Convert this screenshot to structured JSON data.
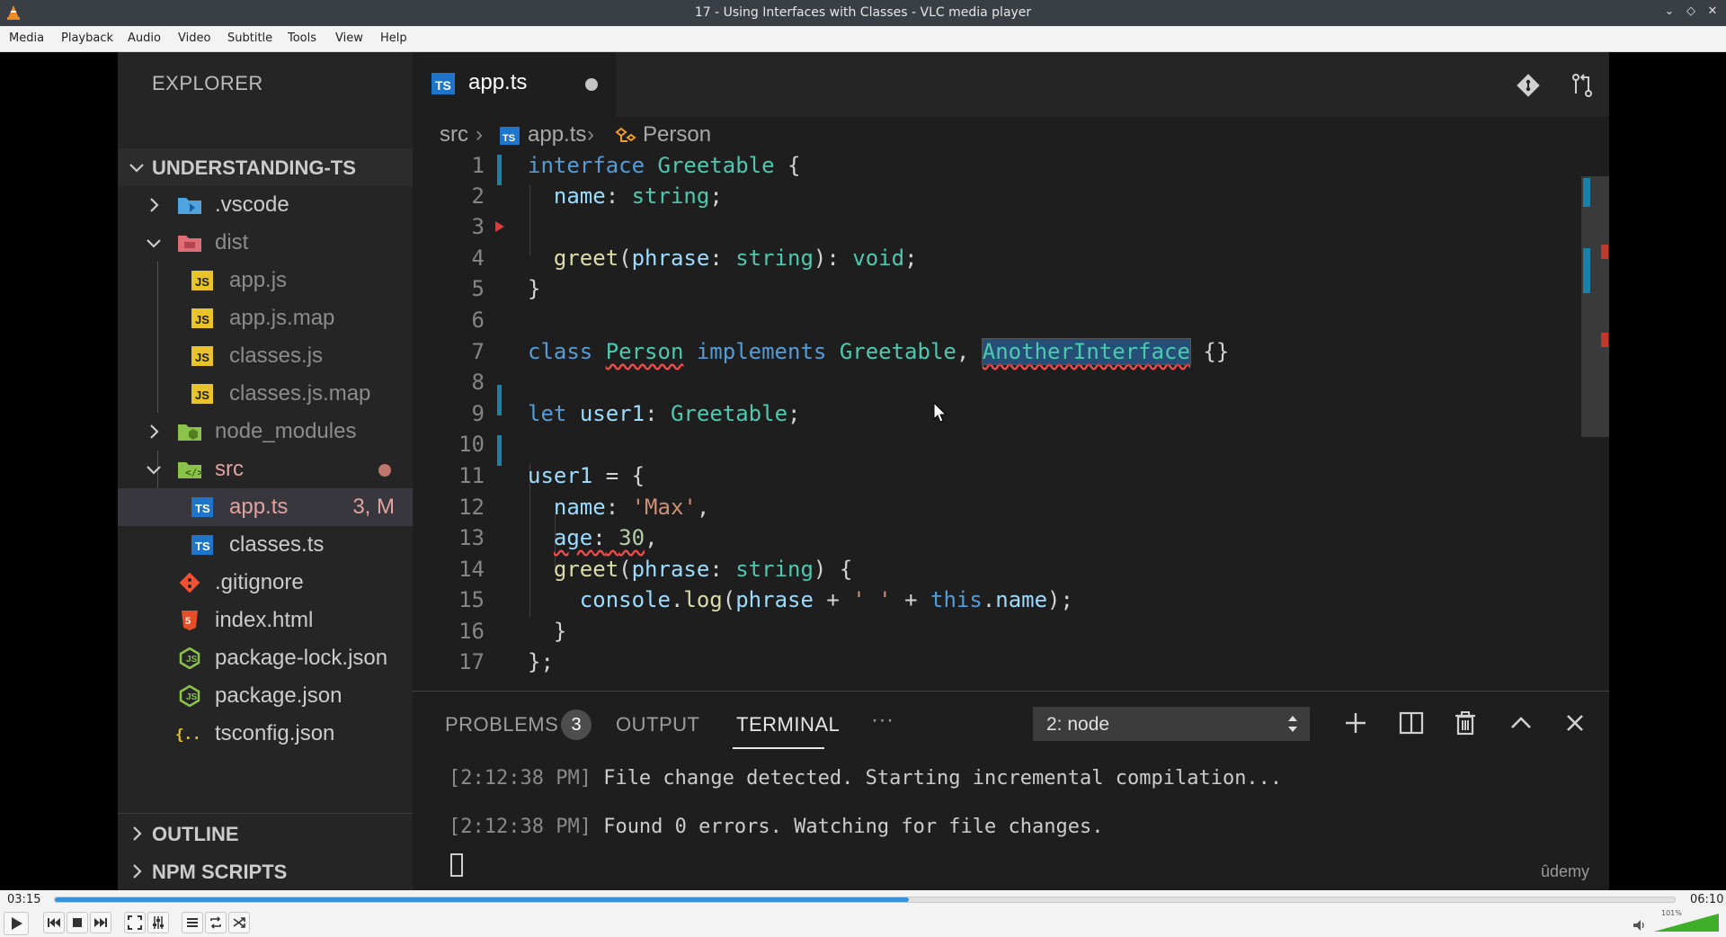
{
  "window": {
    "title": "17 - Using Interfaces with Classes - VLC media player"
  },
  "menu": [
    "Media",
    "Playback",
    "Audio",
    "Video",
    "Subtitle",
    "Tools",
    "View",
    "Help"
  ],
  "explorer": {
    "title": "EXPLORER",
    "project": "UNDERSTANDING-TS",
    "tree": [
      {
        "label": ".vscode",
        "type": "folder",
        "color": "#4fa3e0"
      },
      {
        "label": "dist",
        "type": "folder-open",
        "color": "#e06c75",
        "dim": true
      },
      {
        "label": "app.js",
        "type": "js",
        "dim": true
      },
      {
        "label": "app.js.map",
        "type": "js",
        "dim": true
      },
      {
        "label": "classes.js",
        "type": "js",
        "dim": true
      },
      {
        "label": "classes.js.map",
        "type": "js",
        "dim": true
      },
      {
        "label": "node_modules",
        "type": "folder",
        "color": "#8bc34a",
        "dim": true
      },
      {
        "label": "src",
        "type": "folder-open",
        "color": "#8bc34a"
      },
      {
        "label": "app.ts",
        "type": "ts",
        "badge": "3, M"
      },
      {
        "label": "classes.ts",
        "type": "ts"
      },
      {
        "label": ".gitignore",
        "type": "git"
      },
      {
        "label": "index.html",
        "type": "html"
      },
      {
        "label": "package-lock.json",
        "type": "node"
      },
      {
        "label": "package.json",
        "type": "node"
      },
      {
        "label": "tsconfig.json",
        "type": "json"
      }
    ],
    "outline": "OUTLINE",
    "npm_scripts": "NPM SCRIPTS"
  },
  "editor": {
    "tab": "app.ts",
    "breadcrumb": [
      "src",
      "app.ts",
      "Person"
    ],
    "line_numbers": [
      "1",
      "2",
      "3",
      "4",
      "5",
      "6",
      "7",
      "8",
      "9",
      "10",
      "11",
      "12",
      "13",
      "14",
      "15",
      "16",
      "17"
    ]
  },
  "panel": {
    "tabs": {
      "problems": "PROBLEMS",
      "problems_count": "3",
      "output": "OUTPUT",
      "terminal": "TERMINAL",
      "more": "···"
    },
    "terminal_select": "2: node",
    "terminal_lines": [
      {
        "ts": "[2:12:38 PM]",
        "text": " File change detected. Starting incremental compilation..."
      },
      {
        "ts": "[2:12:38 PM]",
        "text": " Found 0 errors. Watching for file changes."
      }
    ],
    "watermark": "ûdemy"
  },
  "player": {
    "elapsed": "03:15",
    "total": "06:10",
    "progress": 0.527,
    "volume_label": "101%",
    "volume": 1.01
  },
  "colors": {
    "accent": "#3a92d8",
    "ts_icon": "#1f75c9",
    "js_icon": "#e8c42a"
  }
}
